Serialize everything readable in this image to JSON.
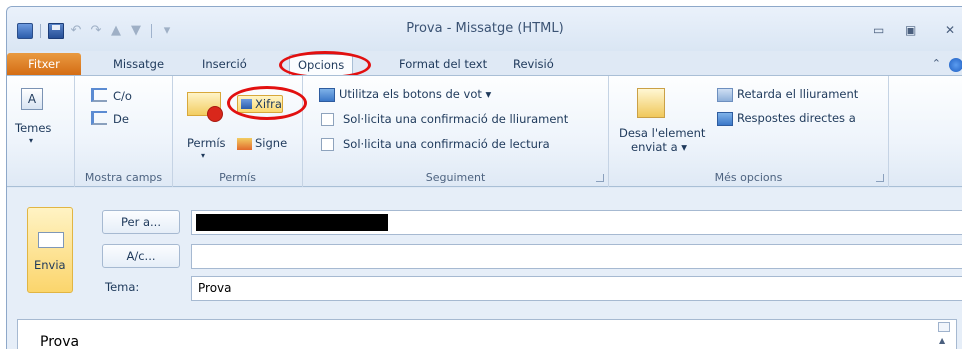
{
  "window": {
    "title": "Prova - Missatge (HTML)"
  },
  "tabs": [
    {
      "label": "Fitxer"
    },
    {
      "label": "Missatge"
    },
    {
      "label": "Inserció"
    },
    {
      "label": "Opcions"
    },
    {
      "label": "Format del text"
    },
    {
      "label": "Revisió"
    }
  ],
  "ribbon": {
    "temes": {
      "label": "Temes"
    },
    "mostra_camps": {
      "label": "Mostra camps",
      "co": "C/o",
      "de": "De"
    },
    "permis": {
      "label": "Permís",
      "xifra": "Xifra",
      "permis_btn": "Permís",
      "signe": "Signe"
    },
    "seguiment": {
      "label": "Seguiment",
      "vot": "Utilitza els botons de vot",
      "confirm_lliurament": "Sol·licita una confirmació de lliurament",
      "confirm_lectura": "Sol·licita una confirmació de lectura"
    },
    "mes_opcions": {
      "label": "Més opcions",
      "desa_line1": "Desa l'element",
      "desa_line2": "enviat a",
      "retarda": "Retarda el lliurament",
      "respostes": "Respostes directes a"
    }
  },
  "compose": {
    "send": "Envia",
    "to_button": "Per a...",
    "cc_button": "A/c...",
    "subject_label": "Tema:",
    "subject_value": "Prova",
    "body_text": "Prova"
  },
  "colors": {
    "file_tab": "#d46d14",
    "highlight_circle": "#e21010",
    "send_button": "#fbd56c"
  }
}
